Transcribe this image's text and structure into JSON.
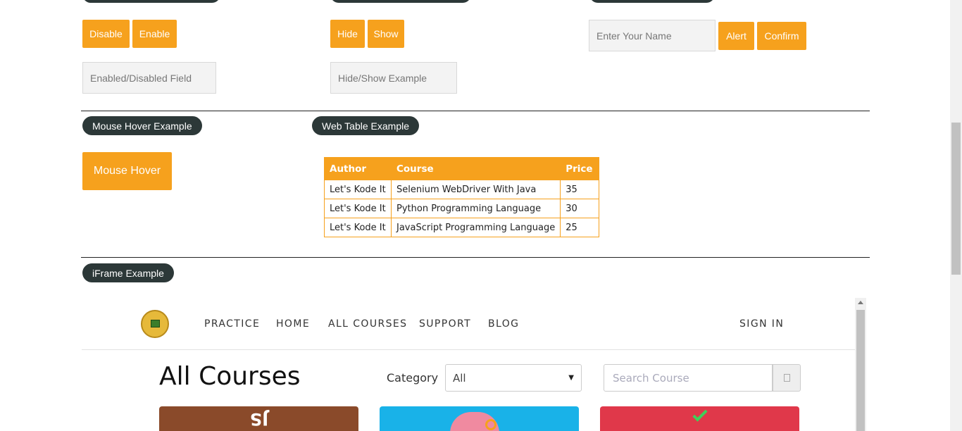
{
  "enable_disable": {
    "disable_label": "Disable",
    "enable_label": "Enable",
    "field_placeholder": "Enabled/Disabled Field"
  },
  "hide_show": {
    "hide_label": "Hide",
    "show_label": "Show",
    "field_placeholder": "Hide/Show Example"
  },
  "alert": {
    "name_placeholder": "Enter Your Name",
    "alert_label": "Alert",
    "confirm_label": "Confirm"
  },
  "mouse_hover": {
    "title": "Mouse Hover Example",
    "button_label": "Mouse Hover"
  },
  "web_table": {
    "title": "Web Table Example",
    "headers": [
      "Author",
      "Course",
      "Price"
    ],
    "rows": [
      [
        "Let's Kode It",
        "Selenium WebDriver With Java",
        "35"
      ],
      [
        "Let's Kode It",
        "Python Programming Language",
        "30"
      ],
      [
        "Let's Kode It",
        "JavaScript Programming Language",
        "25"
      ]
    ]
  },
  "iframe_section": {
    "title": "iFrame Example",
    "nav": [
      "PRACTICE",
      "HOME",
      "ALL COURSES",
      "SUPPORT",
      "BLOG"
    ],
    "sign_in": "SIGN IN",
    "heading": "All Courses",
    "category_label": "Category",
    "category_value": "All",
    "search_placeholder": "Search Course",
    "card_colors": [
      "#8a4a2a",
      "#19b2e8",
      "#e0384a"
    ]
  },
  "colors": {
    "accent": "#f6a11d",
    "pill": "#2c3838"
  }
}
